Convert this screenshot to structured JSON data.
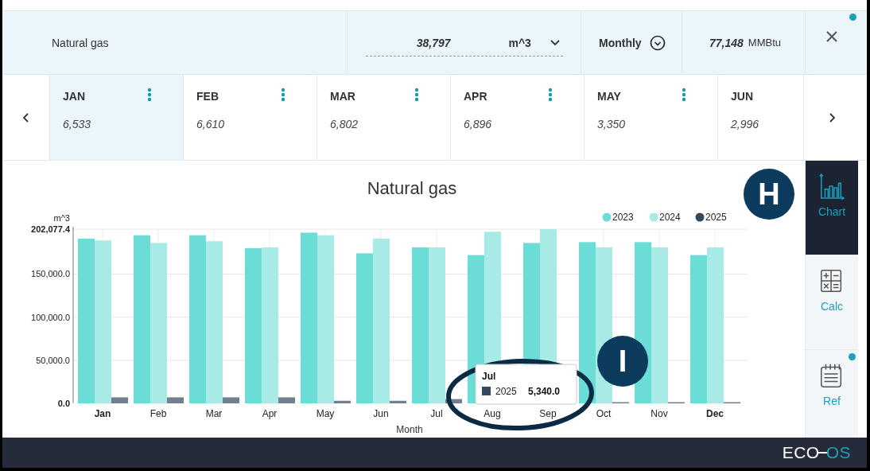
{
  "header": {
    "name": "Natural gas",
    "quantity": {
      "value": "38,797",
      "unit": "m^3"
    },
    "period": "Monthly",
    "energy": {
      "value": "77,148",
      "unit": "MMBtu"
    },
    "close_dot": true
  },
  "months": [
    {
      "label": "JAN",
      "value": "6,533",
      "selected": true,
      "menu": true
    },
    {
      "label": "FEB",
      "value": "6,610",
      "selected": false,
      "menu": true
    },
    {
      "label": "MAR",
      "value": "6,802",
      "selected": false,
      "menu": true
    },
    {
      "label": "APR",
      "value": "6,896",
      "selected": false,
      "menu": true
    },
    {
      "label": "MAY",
      "value": "3,350",
      "selected": false,
      "menu": true
    },
    {
      "label": "JUN",
      "value": "2,996",
      "selected": false,
      "menu": false
    }
  ],
  "chart": {
    "chart_data": {
      "type": "bar",
      "title": "Natural gas",
      "xlabel": "Month",
      "ylabel": "m^3",
      "categories": [
        "Jan",
        "Feb",
        "Mar",
        "Apr",
        "May",
        "Jun",
        "Jul",
        "Aug",
        "Sep",
        "Oct",
        "Nov",
        "Dec"
      ],
      "series": [
        {
          "name": "2023",
          "color": "#6cddd6",
          "values": [
            191000,
            195000,
            195000,
            180000,
            198000,
            174000,
            181000,
            172000,
            186000,
            187000,
            187000,
            172000
          ]
        },
        {
          "name": "2024",
          "color": "#a8eae5",
          "values": [
            189000,
            186000,
            188000,
            181000,
            195000,
            191000,
            181000,
            199000,
            202000,
            181000,
            181000,
            181000
          ]
        },
        {
          "name": "2025",
          "color": "#34495e",
          "values": [
            7000,
            7000,
            7000,
            7000,
            3000,
            3000,
            5000,
            null,
            null,
            1000,
            1000,
            1000
          ]
        }
      ],
      "grid": true,
      "legend": true,
      "ylim": [
        0,
        202077.4
      ],
      "yticks": [
        {
          "value": 0,
          "label": "0.0"
        },
        {
          "value": 50000,
          "label": "50,000.0"
        },
        {
          "value": 100000,
          "label": "100,000.0"
        },
        {
          "value": 150000,
          "label": "150,000.0"
        },
        {
          "value": 202077.4,
          "label": "202,077.4"
        }
      ]
    },
    "tooltip": {
      "title": "Jul",
      "series": "2025",
      "value": "5,340.0"
    }
  },
  "callouts": [
    {
      "label": "H"
    },
    {
      "label": "I"
    }
  ],
  "rail": [
    {
      "label": "Chart",
      "kind": "chart",
      "selected": true,
      "dot": false
    },
    {
      "label": "Calc",
      "kind": "calc",
      "selected": false,
      "dot": false
    },
    {
      "label": "Ref",
      "kind": "ref",
      "selected": false,
      "dot": true
    }
  ],
  "footer": {
    "logo_left": "ECO",
    "logo_right": "OS"
  }
}
